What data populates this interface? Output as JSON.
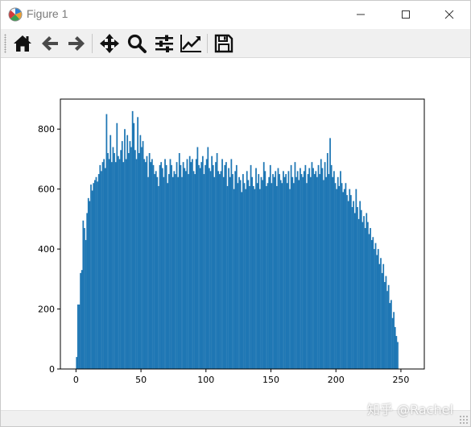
{
  "window": {
    "title": "Figure 1"
  },
  "toolbar": {
    "tools": [
      {
        "name": "home",
        "icon": "home-icon",
        "tooltip": ""
      },
      {
        "name": "back",
        "icon": "back-arrow-icon"
      },
      {
        "name": "forward",
        "icon": "forward-arrow-icon"
      },
      {
        "name": "pan",
        "icon": "move-icon"
      },
      {
        "name": "zoom",
        "icon": "zoom-icon"
      },
      {
        "name": "subplots",
        "icon": "sliders-icon"
      },
      {
        "name": "edit-axis",
        "icon": "line-chart-icon"
      },
      {
        "name": "save",
        "icon": "floppy-icon"
      }
    ]
  },
  "watermark": "知乎 @Rachel",
  "chart_data": {
    "type": "bar",
    "title": "",
    "xlabel": "",
    "ylabel": "",
    "bar_color": "#1f77b4",
    "xlim": [
      -12,
      268
    ],
    "ylim": [
      0,
      900
    ],
    "xticks": [
      0,
      50,
      100,
      150,
      200,
      250
    ],
    "yticks": [
      0,
      200,
      400,
      600,
      800
    ],
    "bin_width": 1,
    "x_start": 0,
    "values": [
      40,
      215,
      215,
      320,
      330,
      495,
      470,
      430,
      520,
      570,
      560,
      615,
      595,
      620,
      630,
      640,
      625,
      650,
      680,
      660,
      690,
      700,
      670,
      850,
      720,
      700,
      780,
      690,
      740,
      720,
      690,
      820,
      710,
      700,
      730,
      760,
      690,
      800,
      700,
      780,
      720,
      760,
      740,
      860,
      820,
      730,
      700,
      840,
      720,
      780,
      740,
      760,
      700,
      690,
      710,
      640,
      720,
      690,
      700,
      680,
      650,
      660,
      640,
      610,
      680,
      690,
      670,
      640,
      700,
      680,
      620,
      650,
      700,
      680,
      640,
      660,
      650,
      690,
      640,
      720,
      680,
      640,
      690,
      670,
      660,
      700,
      650,
      710,
      690,
      700,
      660,
      650,
      700,
      740,
      680,
      670,
      690,
      710,
      650,
      680,
      700,
      740,
      670,
      660,
      710,
      680,
      640,
      690,
      720,
      660,
      650,
      660,
      700,
      640,
      680,
      690,
      610,
      670,
      640,
      700,
      650,
      600,
      660,
      680,
      620,
      640,
      630,
      590,
      650,
      620,
      600,
      660,
      630,
      610,
      680,
      640,
      610,
      600,
      670,
      620,
      650,
      600,
      640,
      630,
      690,
      660,
      610,
      620,
      640,
      680,
      620,
      650,
      640,
      660,
      610,
      670,
      650,
      630,
      620,
      660,
      640,
      650,
      620,
      660,
      600,
      680,
      640,
      620,
      690,
      640,
      660,
      630,
      670,
      650,
      640,
      660,
      680,
      620,
      650,
      670,
      640,
      690,
      670,
      650,
      660,
      640,
      680,
      650,
      700,
      670,
      630,
      690,
      640,
      720,
      650,
      770,
      680,
      640,
      660,
      620,
      600,
      640,
      610,
      660,
      620,
      590,
      600,
      620,
      580,
      560,
      600,
      580,
      540,
      560,
      520,
      600,
      540,
      500,
      560,
      530,
      490,
      510,
      470,
      520,
      490,
      450,
      470,
      430,
      440,
      400,
      420,
      380,
      400,
      350,
      370,
      320,
      350,
      290,
      310,
      260,
      280,
      220,
      230,
      170,
      190,
      140,
      110,
      90
    ]
  }
}
